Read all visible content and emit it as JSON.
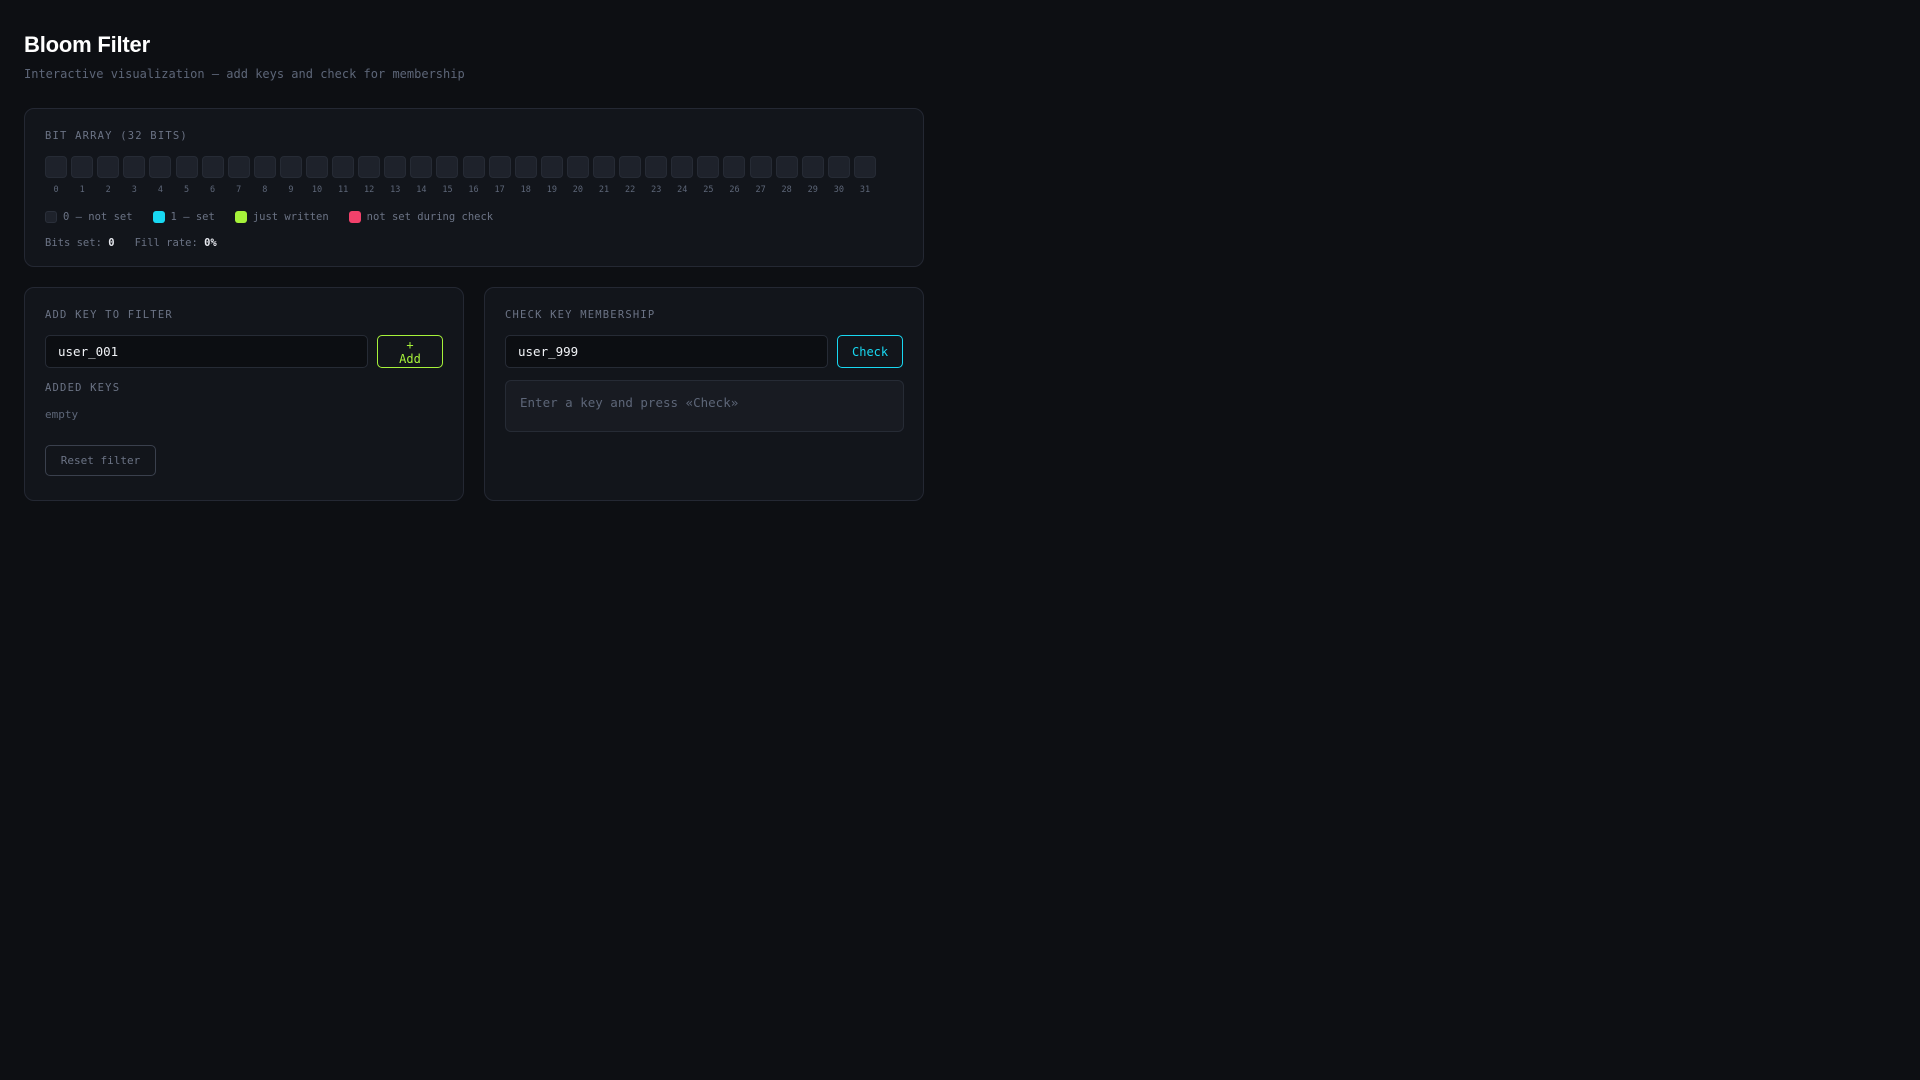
{
  "header": {
    "title": "Bloom Filter",
    "subtitle": "Interactive visualization — add keys and check for membership"
  },
  "bit_array": {
    "label": "BIT ARRAY (32 BITS)",
    "bits": [
      0,
      0,
      0,
      0,
      0,
      0,
      0,
      0,
      0,
      0,
      0,
      0,
      0,
      0,
      0,
      0,
      0,
      0,
      0,
      0,
      0,
      0,
      0,
      0,
      0,
      0,
      0,
      0,
      0,
      0,
      0,
      0
    ],
    "indices": [
      "0",
      "1",
      "2",
      "3",
      "4",
      "5",
      "6",
      "7",
      "8",
      "9",
      "10",
      "11",
      "12",
      "13",
      "14",
      "15",
      "16",
      "17",
      "18",
      "19",
      "20",
      "21",
      "22",
      "23",
      "24",
      "25",
      "26",
      "27",
      "28",
      "29",
      "30",
      "31"
    ]
  },
  "legend": {
    "not_set": "0 — not set",
    "set": "1 — set",
    "just_written": "just written",
    "not_set_check": "not set during check"
  },
  "colors": {
    "set": "#18d8f2",
    "just_written": "#a6f23a",
    "not_set_check": "#f2416b",
    "empty": "#1e222b"
  },
  "stats": {
    "bits_set_label": "Bits set:",
    "bits_set_value": "0",
    "fill_rate_label": "Fill rate:",
    "fill_rate_value": "0%"
  },
  "add_panel": {
    "label": "ADD KEY TO FILTER",
    "input_value": "user_001",
    "add_button": "+ Add",
    "keys_label": "ADDED KEYS",
    "empty_text": "empty",
    "reset_button": "Reset filter"
  },
  "check_panel": {
    "label": "CHECK KEY MEMBERSHIP",
    "input_value": "user_999",
    "check_button": "Check",
    "result_text": "Enter a key and press «Check»"
  }
}
